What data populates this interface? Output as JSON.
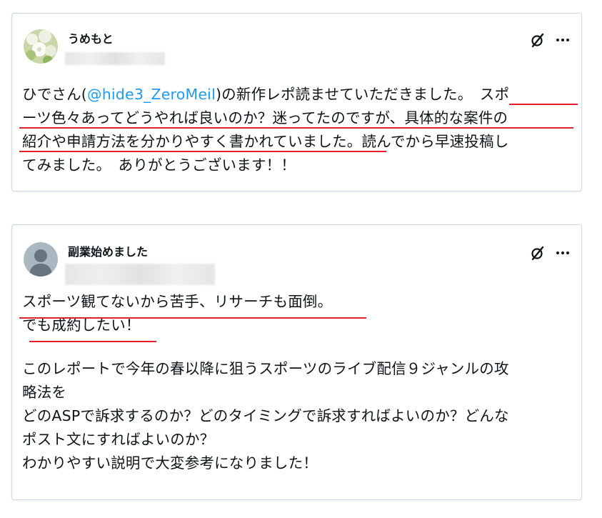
{
  "posts": [
    {
      "username": "うめもと",
      "lines": {
        "l1_a": "ひでさん(",
        "l1_mention": "@hide3_ZeroMeil",
        "l1_b": ")の新作レポ読ませていただきました。　スポ",
        "l2": "ーツ色々あってどうやれば良いのか？迷ってたのですが、具体的な案件の",
        "l3": "紹介や申請方法を分かりやすく書かれていました。読んでから早速投稿し",
        "l4": "てみました。　ありがとうございます！！"
      }
    },
    {
      "username": "副業始めました",
      "lines": {
        "l1": "スポーツ観てないから苦手、リサーチも面倒。",
        "l2": "でも成約したい！",
        "l3": "このレポートで今年の春以降に狙うスポーツのライブ配信９ジャンルの攻",
        "l4": "略法を",
        "l5": "どのASPで訴求するのか？どのタイミングで訴求すればよいのか？どんな",
        "l6": "ポスト文にすればよいのか？",
        "l7": "わかりやすい説明で大変参考になりました！"
      }
    }
  ],
  "icons": {
    "grok": "slashed-circle-icon",
    "more": "more-horizontal-icon",
    "avatar_default": "default-person-icon"
  },
  "colors": {
    "mention": "#1d9bf0",
    "underline": "#e0202b",
    "border": "#cfd9de",
    "text": "#0f1419"
  }
}
